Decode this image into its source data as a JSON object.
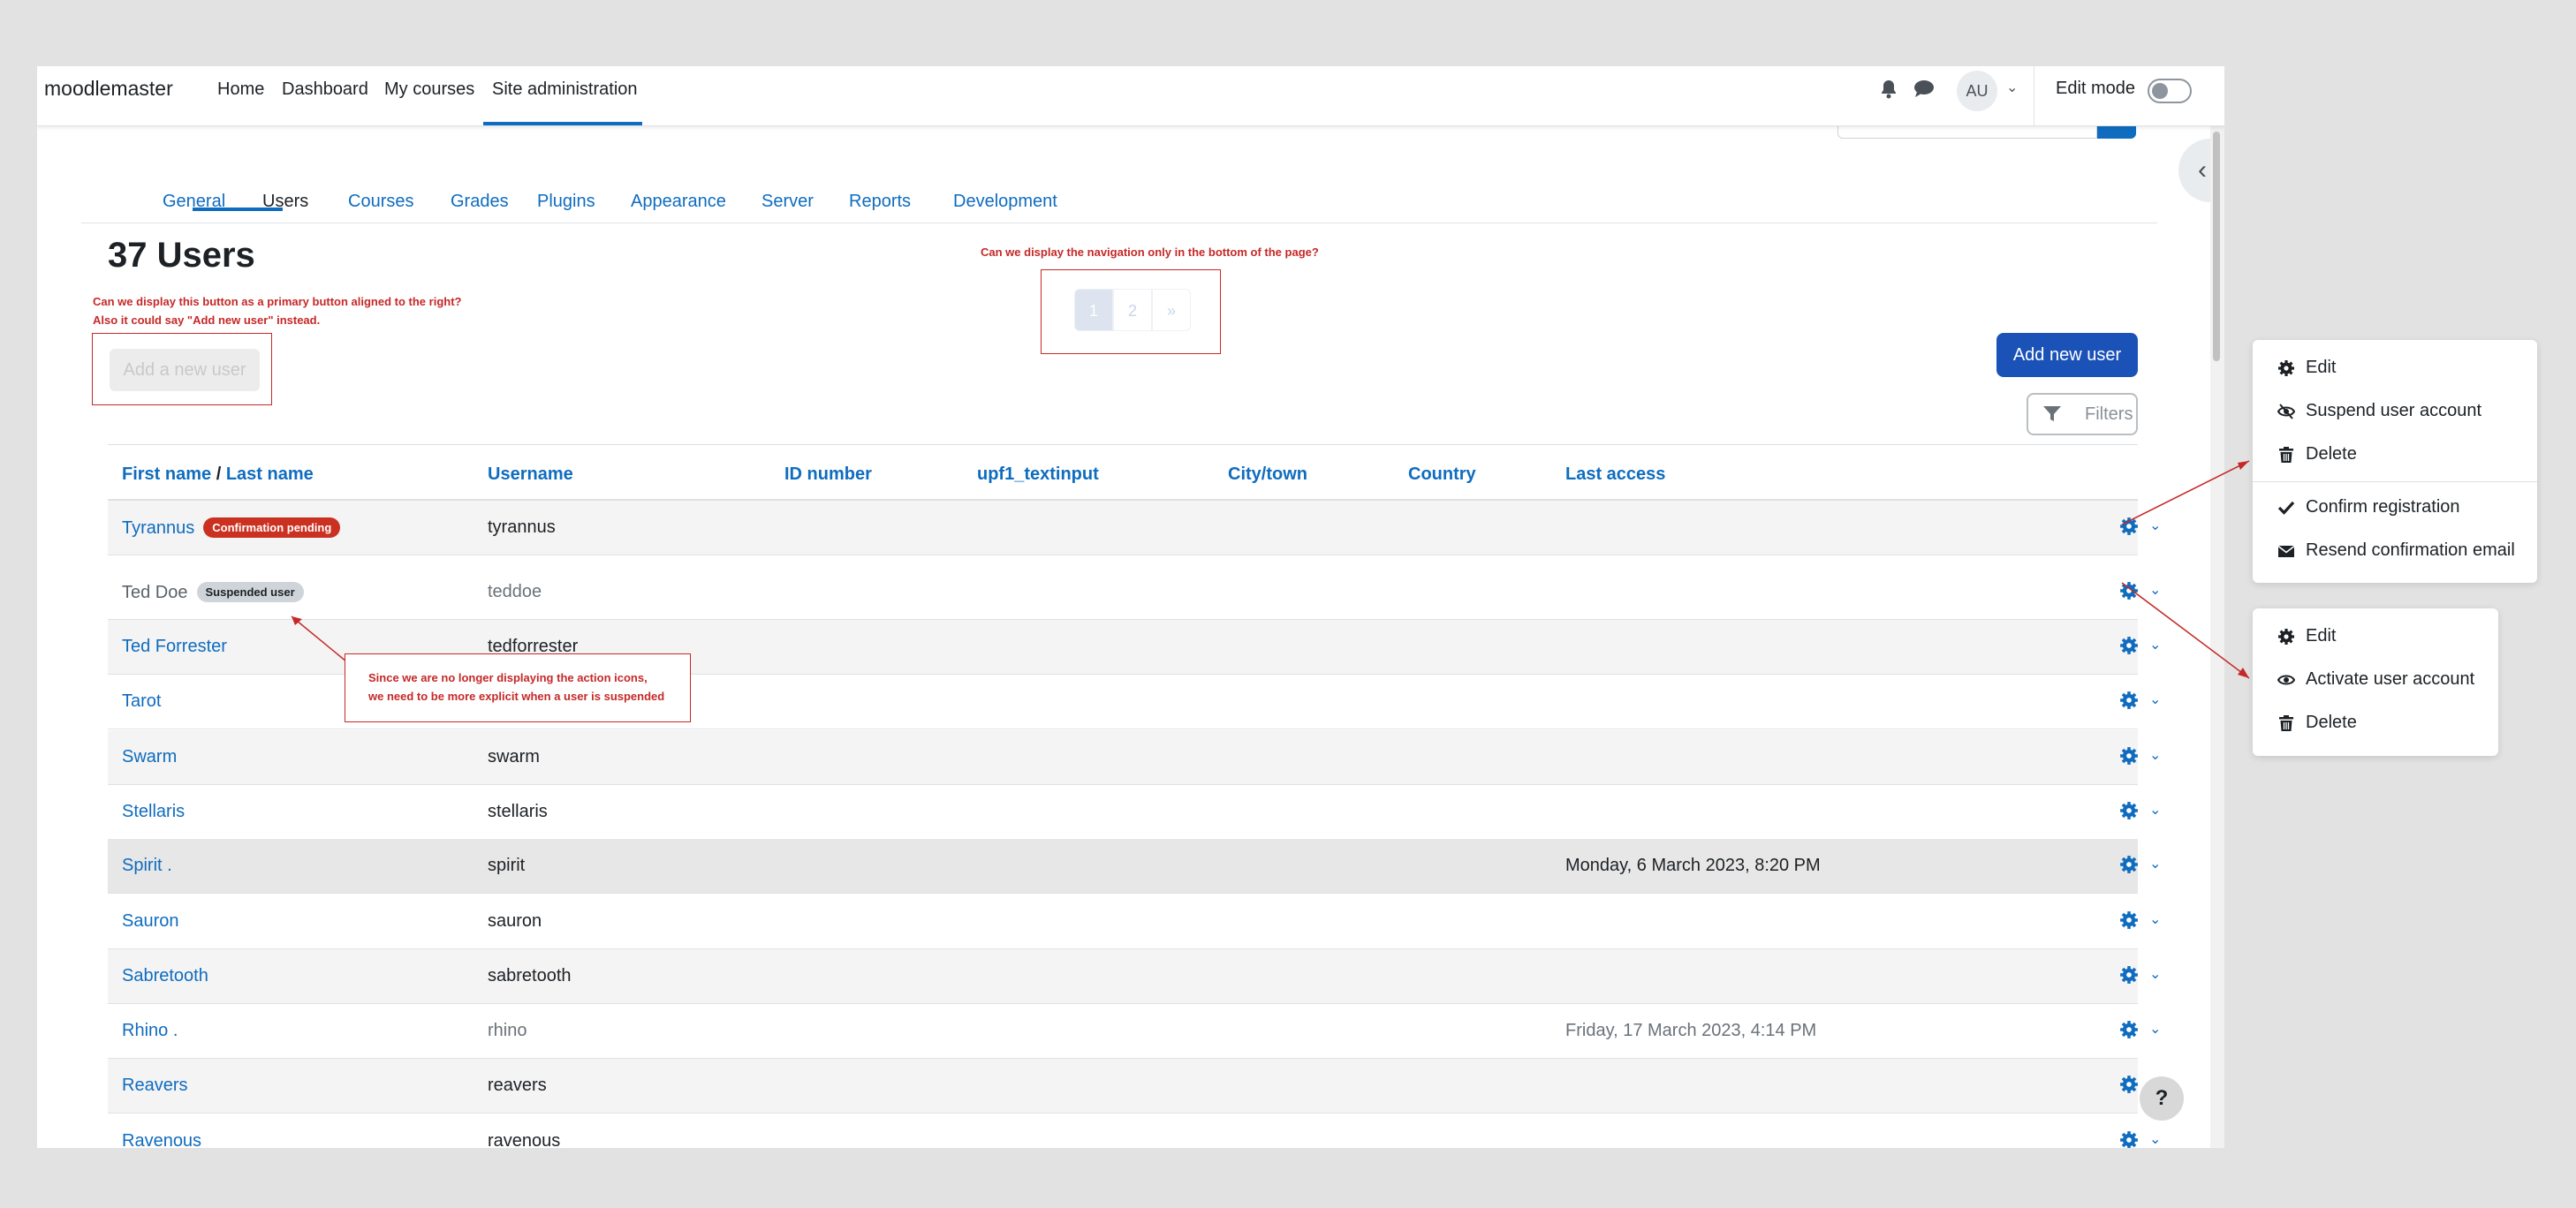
{
  "app": {
    "brand": "moodlemaster"
  },
  "topnav": {
    "items": [
      "Home",
      "Dashboard",
      "My courses",
      "Site administration"
    ],
    "avatar": "AU",
    "edit_mode": "Edit mode"
  },
  "secondary_nav": {
    "tabs": [
      "General",
      "Users",
      "Courses",
      "Grades",
      "Plugins",
      "Appearance",
      "Server",
      "Reports",
      "Development"
    ],
    "active": "Users"
  },
  "page": {
    "title": "37 Users",
    "add_user_ghost": "Add a new user",
    "add_new_button": "Add new user",
    "filters_button": "Filters",
    "pagination": {
      "pages": [
        "1",
        "2"
      ],
      "next": "»",
      "current": "1"
    }
  },
  "annotations": {
    "button_note_line1": "Can we display this button as a primary button aligned to the right?",
    "button_note_line2": "Also it could say \"Add new user\" instead.",
    "nav_note": "Can we display the navigation only in the bottom of the page?",
    "suspended_note_line1": "Since we are no longer displaying the action icons,",
    "suspended_note_line2": "we need to be more explicit when a user is suspended"
  },
  "table": {
    "headers": {
      "first_name": "First name",
      "slash": "/",
      "last_name": "Last name",
      "username": "Username",
      "id_number": "ID number",
      "custom": "upf1_textinput",
      "city": "City/town",
      "country": "Country",
      "last_access": "Last access"
    },
    "rows": [
      {
        "name": "Tyrannus",
        "badge": "Confirmation pending",
        "username": "tyrannus",
        "last_access": ""
      },
      {
        "name": "Ted Doe",
        "badge": "Suspended user",
        "username": "teddoe",
        "last_access": ""
      },
      {
        "name": "Ted Forrester",
        "badge": "",
        "username": "tedforrester",
        "last_access": ""
      },
      {
        "name": "Tarot",
        "badge": "",
        "username": "",
        "last_access": ""
      },
      {
        "name": "Swarm",
        "badge": "",
        "username": "swarm",
        "last_access": ""
      },
      {
        "name": "Stellaris",
        "badge": "",
        "username": "stellaris",
        "last_access": ""
      },
      {
        "name": "Spirit .",
        "badge": "",
        "username": "spirit",
        "last_access": "Monday, 6 March 2023, 8:20 PM"
      },
      {
        "name": "Sauron",
        "badge": "",
        "username": "sauron",
        "last_access": ""
      },
      {
        "name": "Sabretooth",
        "badge": "",
        "username": "sabretooth",
        "last_access": ""
      },
      {
        "name": "Rhino .",
        "badge": "",
        "username": "rhino",
        "last_access": "Friday, 17 March 2023, 4:14 PM"
      },
      {
        "name": "Reavers",
        "badge": "",
        "username": "reavers",
        "last_access": ""
      },
      {
        "name": "Ravenous",
        "badge": "",
        "username": "ravenous",
        "last_access": ""
      }
    ]
  },
  "menus": {
    "pending_user": [
      "Edit",
      "Suspend user account",
      "Delete",
      "Confirm registration",
      "Resend confirmation email"
    ],
    "suspended_user": [
      "Edit",
      "Activate user account",
      "Delete"
    ]
  },
  "help": "?",
  "colors": {
    "link": "#0f6cbf",
    "primary": "#1a52b8",
    "annotation": "#c62828",
    "badge_pending": "#ca3120"
  }
}
